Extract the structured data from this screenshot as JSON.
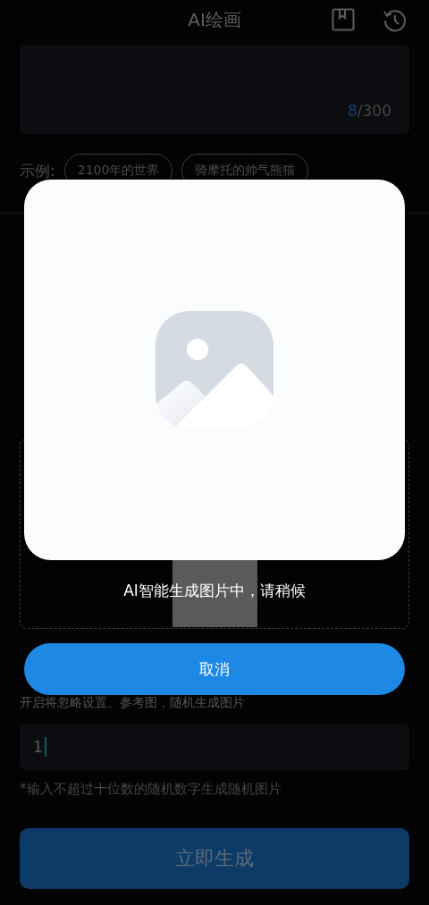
{
  "header": {
    "title": "AI绘画"
  },
  "prompt": {
    "count_typed": "8",
    "count_max": "/300"
  },
  "examples": {
    "label": "示例:",
    "chips": [
      "2100年的世界",
      "骑摩托的帅气熊猫"
    ]
  },
  "random_mode": {
    "hint": "开启将忽略设置、参考图，随机生成图片"
  },
  "seed": {
    "value": "1",
    "note": "*输入不超过十位数的随机数字生成随机图片"
  },
  "generate_button": "立即生成",
  "dialog": {
    "message": "AI智能生成图片中，请稍候",
    "cancel_button": "取消"
  }
}
